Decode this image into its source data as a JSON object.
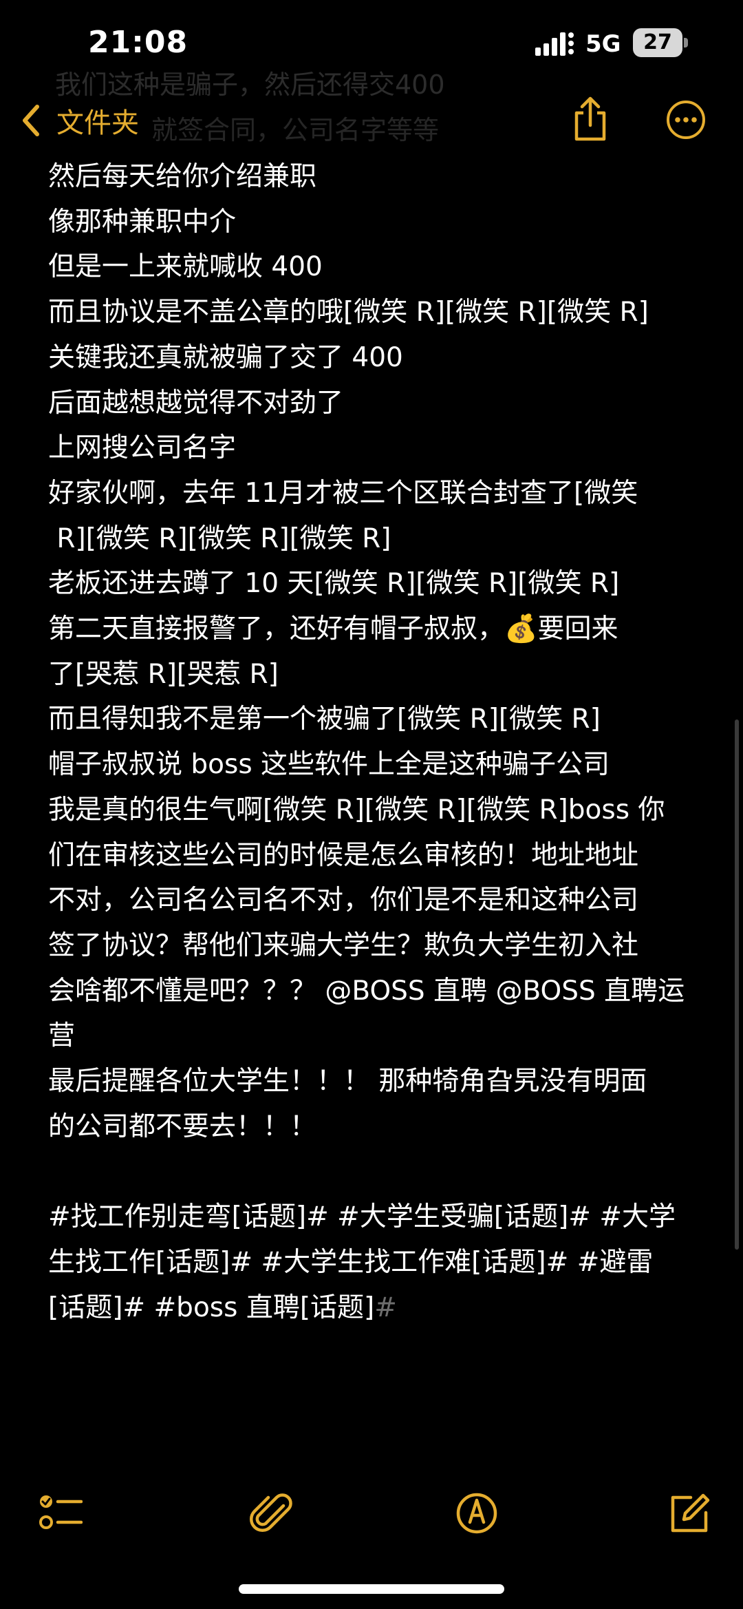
{
  "status_bar": {
    "time": "21:08",
    "network": "5G",
    "battery": "27"
  },
  "header": {
    "back_label": "文件夹",
    "ghost_line_1": "我们这种是骗子，然后还得交400",
    "ghost_line_2": "就签合同，公司名字等等"
  },
  "note": {
    "lines": [
      "然后每天给你介绍兼职",
      "像那种兼职中介",
      "但是一上来就喊收 400",
      "而且协议是不盖公章的哦[微笑 R][微笑 R][微笑 R]",
      "关键我还真就被骗了交了 400",
      "后面越想越觉得不对劲了",
      "上网搜公司名字",
      "好家伙啊，去年 11月才被三个区联合封查了[微笑",
      " R][微笑 R][微笑 R][微笑 R]",
      "老板还进去蹲了 10 天[微笑 R][微笑 R][微笑 R]",
      "第二天直接报警了，还好有帽子叔叔，💰要回来",
      "了[哭惹 R][哭惹 R]",
      "而且得知我不是第一个被骗了[微笑 R][微笑 R]",
      "帽子叔叔说 boss 这些软件上全是这种骗子公司",
      "我是真的很生气啊[微笑 R][微笑 R][微笑 R]boss 你",
      "们在审核这些公司的时候是怎么审核的！地址地址",
      "不对，公司名公司名不对，你们是不是和这种公司",
      "签了协议？帮他们来骗大学生？欺负大学生初入社",
      "会啥都不懂是吧？？？ @BOSS 直聘 @BOSS 直聘运",
      "营",
      "最后提醒各位大学生！！！ 那种犄角旮旯没有明面",
      "的公司都不要去！！！",
      "",
      "#找工作别走弯[话题]# #大学生受骗[话题]# #大学",
      "生找工作[话题]# #大学生找工作难[话题]# #避雷",
      "[话题]# #boss 直聘[话题]"
    ],
    "last_char": "#"
  },
  "colors": {
    "accent": "#e5ad2f",
    "background": "#000000",
    "text": "#ffffff"
  },
  "icons": {
    "back": "chevron-left-icon",
    "share": "share-icon",
    "more": "more-icon",
    "checklist": "checklist-icon",
    "attach": "paperclip-icon",
    "markup": "pen-circle-icon",
    "compose": "compose-icon"
  }
}
